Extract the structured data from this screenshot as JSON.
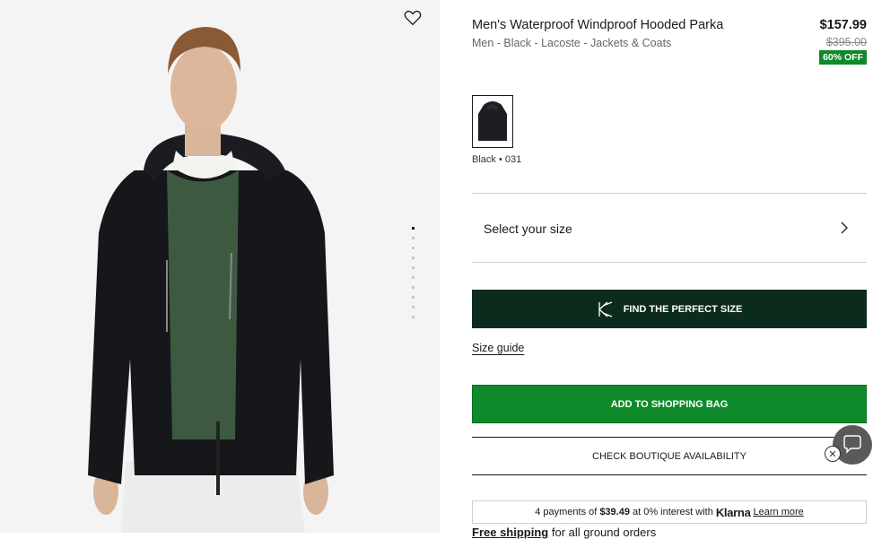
{
  "product": {
    "title": "Men's Waterproof Windproof Hooded Parka",
    "breadcrumbs": "Men - Black - Lacoste - Jackets & Coats",
    "price": "$157.99",
    "original_price": "$395.00",
    "discount_badge": "60% OFF"
  },
  "gallery": {
    "image_icon": "product-photo",
    "wishlist_icon": "heart-icon",
    "dot_count": 10,
    "active_dot": 1
  },
  "color": {
    "label": "Black • 031"
  },
  "size": {
    "label": "Select your size"
  },
  "buttons": {
    "fit": "FIND THE PERFECT SIZE",
    "size_guide": "Size guide",
    "add_to_bag": "ADD TO SHOPPING BAG",
    "boutique": "CHECK BOUTIQUE AVAILABILITY"
  },
  "klarna": {
    "prefix": "4 payments of",
    "amount": "$39.49",
    "middle": "at 0% interest with",
    "brand": "Klarna",
    "learn_more": "Learn more"
  },
  "shipping": {
    "bold": "Free shipping",
    "rest": "for all ground orders"
  },
  "colors": {
    "brand_green": "#0e8a2a",
    "dark_green": "#0b2b1c"
  }
}
